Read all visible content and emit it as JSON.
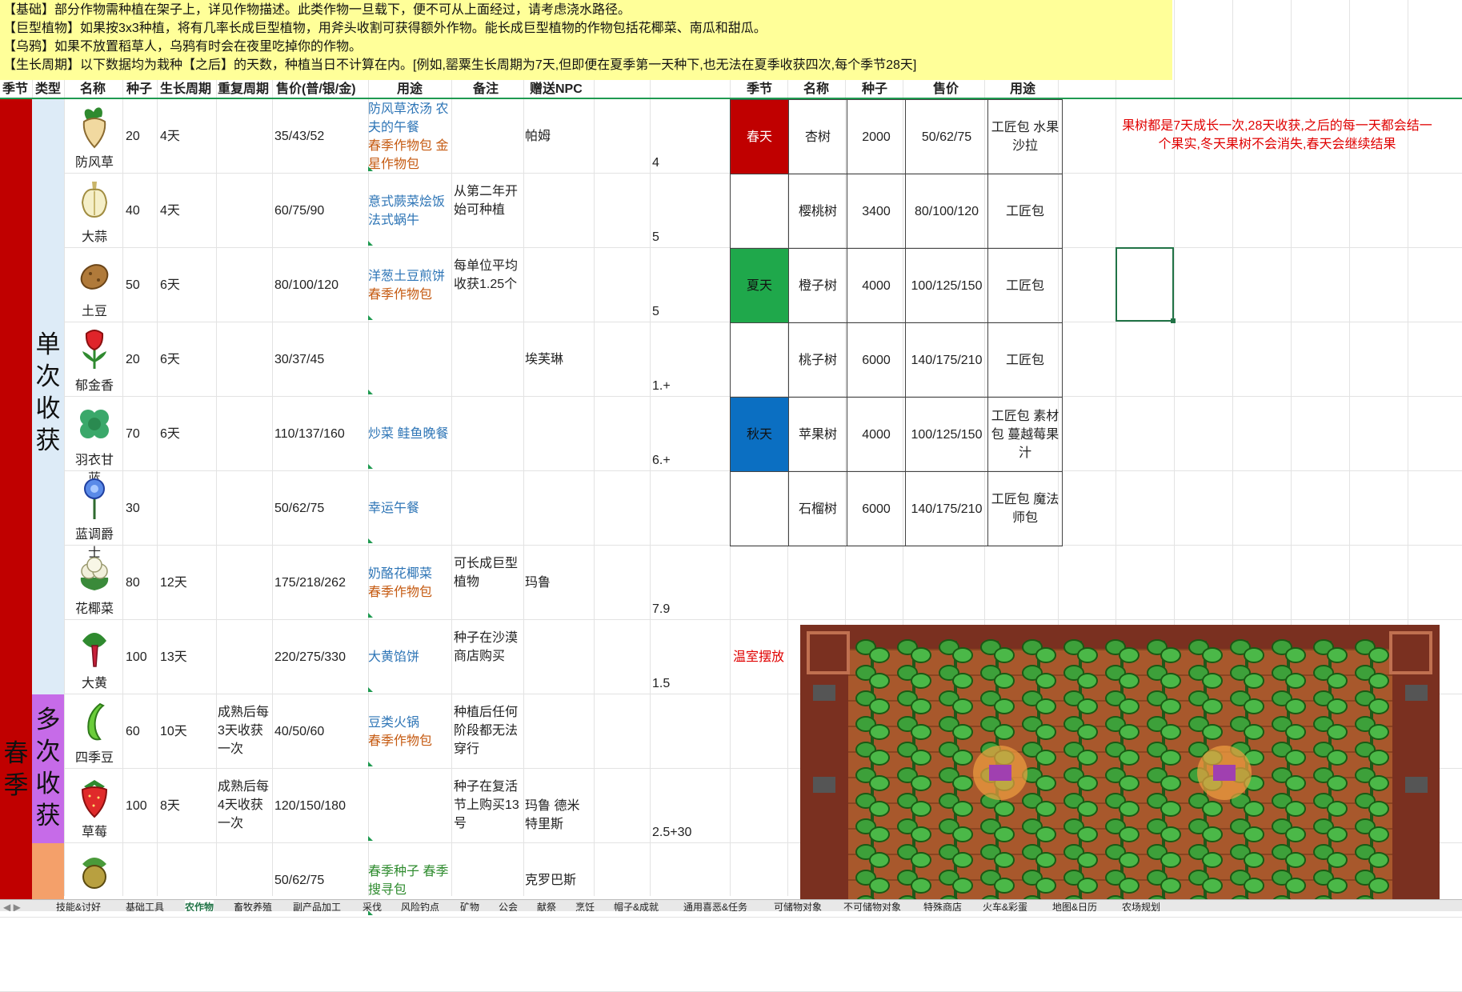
{
  "notes": [
    "【基础】部分作物需种植在架子上，详见作物描述。此类作物一旦载下，便不可从上面经过，请考虑浇水路径。",
    "【巨型植物】如果按3x3种植，将有几率长成巨型植物，用斧头收割可获得额外作物。能长成巨型植物的作物包括花椰菜、南瓜和甜瓜。",
    "【乌鸦】如果不放置稻草人，乌鸦有时会在夜里吃掉你的作物。",
    "【生长周期】以下数据均为栽种【之后】的天数，种植当日不计算在内。[例如,罂粟生长周期为7天,但即便在夏季第一天种下,也无法在夏季收获四次,每个季节28天]"
  ],
  "headers": {
    "season": "季节",
    "type": "类型",
    "name": "名称",
    "seed": "种子",
    "growth": "生长周期",
    "regrow": "重复周期",
    "price": "售价(普/银/金)",
    "use": "用途",
    "remark": "备注",
    "npc": "赠送NPC"
  },
  "tree_headers": {
    "season": "季节",
    "name": "名称",
    "seed": "种子",
    "price": "售价",
    "use": "用途"
  },
  "season_label": "春季",
  "type_single": "单次收获",
  "type_multi": "多次收获",
  "crops": [
    {
      "name": "防风草",
      "icon": "parsnip-icon",
      "seed": "20",
      "growth": "4天",
      "regrow": "",
      "price": "35/43/52",
      "use_blue": "防风草浓汤 农夫的午餐",
      "use_orange": "春季作物包 金星作物包",
      "remark": "",
      "npc": "帕姆",
      "extra": "4"
    },
    {
      "name": "大蒜",
      "icon": "garlic-icon",
      "seed": "40",
      "growth": "4天",
      "regrow": "",
      "price": "60/75/90",
      "use_blue": "意式蕨菜烩饭 法式蜗牛",
      "use_orange": "",
      "remark": "从第二年开始可种植",
      "npc": "",
      "extra": "5"
    },
    {
      "name": "土豆",
      "icon": "potato-icon",
      "seed": "50",
      "growth": "6天",
      "regrow": "",
      "price": "80/100/120",
      "use_blue": "洋葱土豆煎饼",
      "use_orange": "春季作物包",
      "remark": "每单位平均收获1.25个",
      "npc": "",
      "extra": "5"
    },
    {
      "name": "郁金香",
      "icon": "tulip-icon",
      "seed": "20",
      "growth": "6天",
      "regrow": "",
      "price": "30/37/45",
      "use_blue": "",
      "use_orange": "",
      "remark": "",
      "npc": "埃芙琳",
      "extra": "1.+"
    },
    {
      "name": "羽衣甘蓝",
      "icon": "kale-icon",
      "seed": "70",
      "growth": "6天",
      "regrow": "",
      "price": "110/137/160",
      "use_blue": "炒菜 鲑鱼晚餐",
      "use_orange": "",
      "remark": "",
      "npc": "",
      "extra": "6.+"
    },
    {
      "name": "蓝调爵士",
      "icon": "blue-jazz-icon",
      "seed": "30",
      "growth": "",
      "regrow": "",
      "price": "50/62/75",
      "use_blue": "幸运午餐",
      "use_orange": "",
      "remark": "",
      "npc": "",
      "extra": ""
    },
    {
      "name": "花椰菜",
      "icon": "cauliflower-icon",
      "seed": "80",
      "growth": "12天",
      "regrow": "",
      "price": "175/218/262",
      "use_blue": "奶酪花椰菜",
      "use_orange": "春季作物包",
      "remark": "可长成巨型植物",
      "npc": "玛鲁",
      "extra": "7.9"
    },
    {
      "name": "大黄",
      "icon": "rhubarb-icon",
      "seed": "100",
      "growth": "13天",
      "regrow": "",
      "price": "220/275/330",
      "use_blue": "大黄馅饼",
      "use_orange": "",
      "remark": "种子在沙漠商店购买",
      "npc": "",
      "extra": "1.5"
    },
    {
      "name": "四季豆",
      "icon": "green-bean-icon",
      "seed": "60",
      "growth": "10天",
      "regrow": "成熟后每3天收获一次",
      "price": "40/50/60",
      "use_blue": "豆类火锅",
      "use_orange": "春季作物包",
      "remark": "种植后任何阶段都无法穿行",
      "npc": "",
      "extra": ""
    },
    {
      "name": "草莓",
      "icon": "strawberry-icon",
      "seed": "100",
      "growth": "8天",
      "regrow": "成熟后每4天收获一次",
      "price": "120/150/180",
      "use_blue": "",
      "use_orange": "",
      "remark": "种子在复活节上购买13号",
      "npc": "玛鲁 德米特里斯",
      "extra": "2.5+30"
    },
    {
      "name": "",
      "icon": "coffee-bean-icon",
      "seed": "",
      "growth": "",
      "regrow": "",
      "price": "50/62/75",
      "use_blue": "",
      "use_orange": "",
      "use_green": "春季种子 春季搜寻包",
      "remark": "",
      "npc": "克罗巴斯",
      "extra": ""
    }
  ],
  "trees": [
    {
      "season": "春天",
      "season_color": "#c00000",
      "name": "杏树",
      "seed": "2000",
      "price": "50/62/75",
      "use": "工匠包 水果沙拉"
    },
    {
      "season": "",
      "season_color": "",
      "name": "樱桃树",
      "seed": "3400",
      "price": "80/100/120",
      "use": "工匠包"
    },
    {
      "season": "夏天",
      "season_color": "#1fa84b",
      "name": "橙子树",
      "seed": "4000",
      "price": "100/125/150",
      "use": "工匠包"
    },
    {
      "season": "",
      "season_color": "",
      "name": "桃子树",
      "seed": "6000",
      "price": "140/175/210",
      "use": "工匠包"
    },
    {
      "season": "秋天",
      "season_color": "#0b6fc2",
      "name": "苹果树",
      "seed": "4000",
      "price": "100/125/150",
      "use": "工匠包 素材包 蔓越莓果汁"
    },
    {
      "season": "",
      "season_color": "",
      "name": "石榴树",
      "seed": "6000",
      "price": "140/175/210",
      "use": "工匠包 魔法师包"
    }
  ],
  "fruit_note": "果树都是7天成长一次,28天收获,之后的每一天都会结一个果实,冬天果树不会消失,春天会继续结果",
  "greenhouse_label": "温室摆放",
  "tabs": [
    "技能&讨好",
    "基础工具",
    "农作物",
    "畜牧养殖",
    "副产品加工",
    "采伐",
    "风险钓点",
    "矿物",
    "公会",
    "献祭",
    "烹饪",
    "帽子&成就",
    "通用喜恶&任务",
    "可储物对象",
    "不可储物对象",
    "特殊商店",
    "火车&彩蛋",
    "地图&日历",
    "农场规划"
  ],
  "active_tab": "农作物"
}
